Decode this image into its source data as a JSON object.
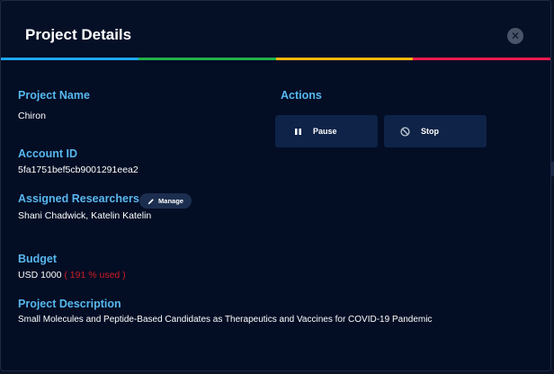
{
  "modal": {
    "title": "Project Details",
    "close_icon": "close-icon"
  },
  "colors": {
    "accent_label": "#58b7ee",
    "bar": [
      "#1da6f0",
      "#22b14c",
      "#f0b90b",
      "#ec1a4d"
    ],
    "used_red": "#d01c24"
  },
  "project": {
    "name_label": "Project Name",
    "name_value": "Chiron",
    "account_label": "Account ID",
    "account_value": "5fa1751bef5cb9001291eea2",
    "researchers_label": "Assigned Researchers",
    "manage_label": "Manage",
    "researchers_value": "Shani Chadwick, Katelin Katelin",
    "budget_label": "Budget",
    "budget_value": "USD 1000",
    "budget_used": "( 191 % used )",
    "description_label": "Project Description",
    "description_value": "Small Molecules and Peptide-Based Candidates as Therapeutics and Vaccines for COVID-19 Pandemic"
  },
  "actions": {
    "label": "Actions",
    "pause_label": "Pause",
    "stop_label": "Stop"
  }
}
